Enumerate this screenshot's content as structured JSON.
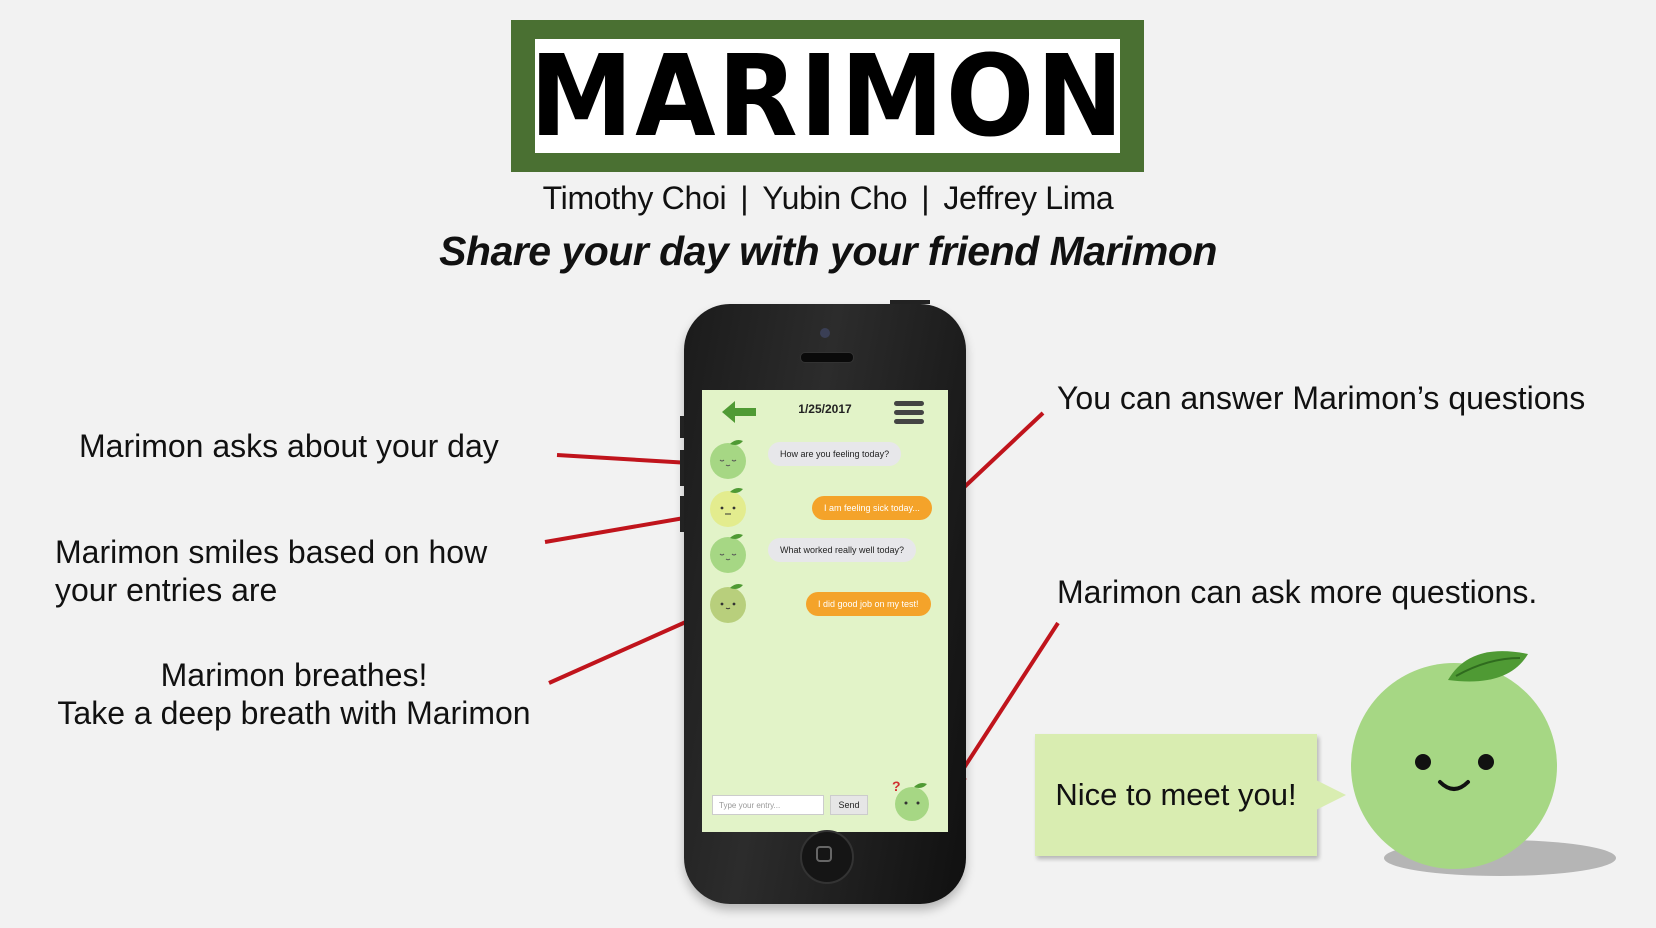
{
  "logo": {
    "title": "MARIMON"
  },
  "authors": [
    "Timothy Choi",
    "Yubin Cho",
    "Jeffrey Lima"
  ],
  "author_separator": "|",
  "tagline": "Share your day with your friend Marimon",
  "annotations": {
    "asks": "Marimon asks about your day",
    "smiles_line1": "Marimon smiles based on how",
    "smiles_line2": "your entries are",
    "breathes_line1": "Marimon breathes!",
    "breathes_line2": "Take a deep breath with Marimon",
    "answer": "You can answer Marimon’s questions",
    "more": "Marimon can ask more questions."
  },
  "app": {
    "date": "1/25/2017",
    "messages": [
      {
        "from": "marimon",
        "text": "How are you feeling today?"
      },
      {
        "from": "user",
        "text": "I am feeling sick today..."
      },
      {
        "from": "marimon",
        "text": "What worked really well today?"
      },
      {
        "from": "user",
        "text": "I did good job on my test!"
      }
    ],
    "input_placeholder": "Type your entry...",
    "send_label": "Send",
    "question_mark": "?"
  },
  "speech": {
    "text": "Nice to meet you!"
  },
  "colors": {
    "logo_frame": "#4a7032",
    "screen_bg": "#e2f3c8",
    "user_bubble": "#f4a32a",
    "marimon_bubble": "#e7e7ea",
    "marimon_green": "#a6d784",
    "leaf_green": "#4f9a34",
    "arrow_red": "#c0141c",
    "speech_bg": "#d9edb1"
  }
}
